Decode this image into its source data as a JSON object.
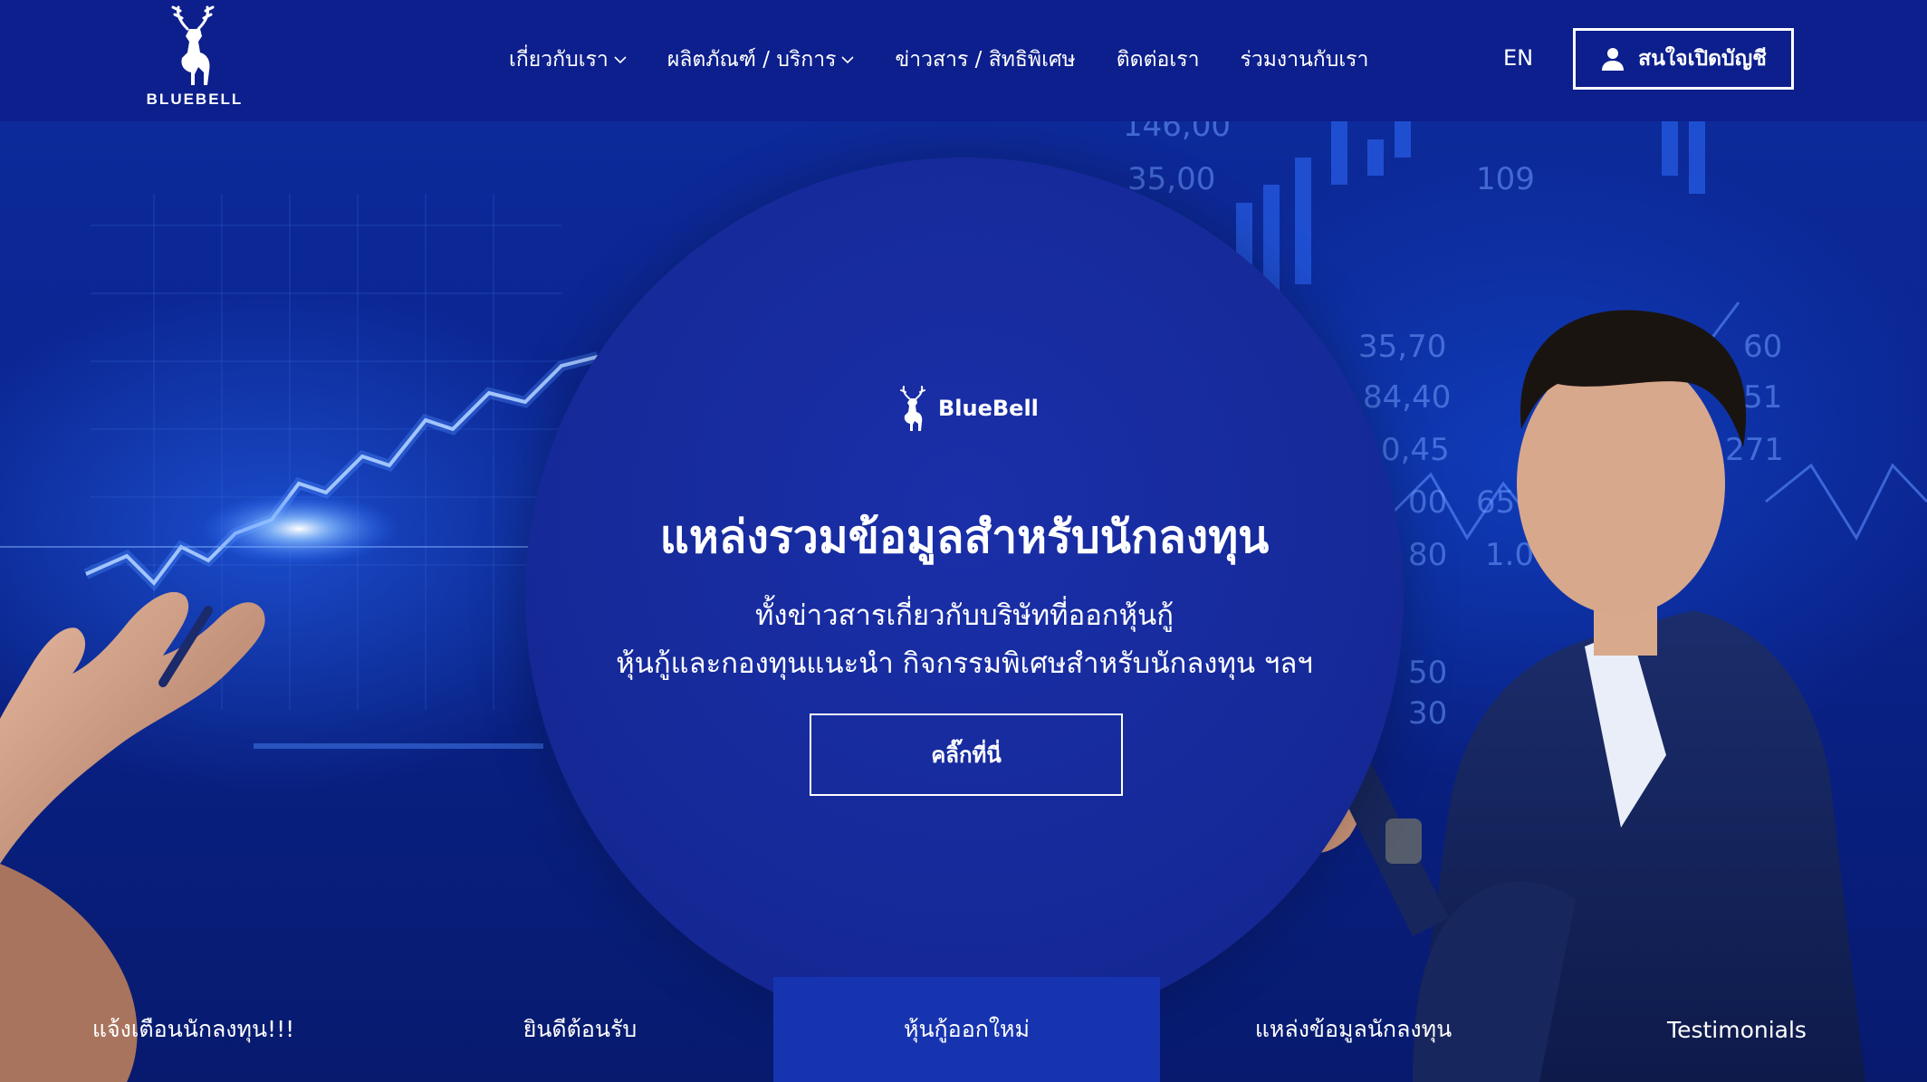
{
  "header": {
    "logo_text": "BLUEBELL",
    "nav": [
      {
        "label": "เกี่ยวกับเรา",
        "has_dropdown": true
      },
      {
        "label": "ผลิตภัณฑ์ / บริการ",
        "has_dropdown": true
      },
      {
        "label": "ข่าวสาร / สิทธิพิเศษ",
        "has_dropdown": false
      },
      {
        "label": "ติดต่อเรา",
        "has_dropdown": false
      },
      {
        "label": "ร่วมงานกับเรา",
        "has_dropdown": false
      }
    ],
    "language": "EN",
    "open_account_label": "สนใจเปิดบัญชี",
    "open_account_icon": "user-icon"
  },
  "hero": {
    "brand_name": "BlueBell",
    "headline": "แหล่งรวมข้อมูลสำหรับนักลงทุน",
    "subtitle_line1": "ทั้งข่าวสารเกี่ยวกับบริษัทที่ออกหุ้นกู้",
    "subtitle_line2": "หุ้นกู้และกองทุนแนะนำ กิจกรรมพิเศษสำหรับนักลงทุน ฯลฯ",
    "cta_label": "คลิ๊กที่นี่",
    "ticker_numbers": [
      "146.00",
      "35.00",
      "35.70",
      "84.40",
      "0.45",
      "00",
      "656",
      "80",
      "1.002",
      "109",
      "50",
      "30",
      "271",
      "51",
      "60"
    ]
  },
  "tabs": {
    "active_index": 2,
    "items": [
      "แจ้งเตือนนักลงทุน!!!",
      "ยินดีต้อนรับ",
      "หุ้นกู้ออกใหม่",
      "แหล่งข้อมูลนักลงทุน",
      "Testimonials"
    ]
  },
  "colors": {
    "header_bg": "#0d1f8c",
    "circle_bg": "#162a9a",
    "active_tab_bg": "#1734b0",
    "text": "#ffffff"
  }
}
